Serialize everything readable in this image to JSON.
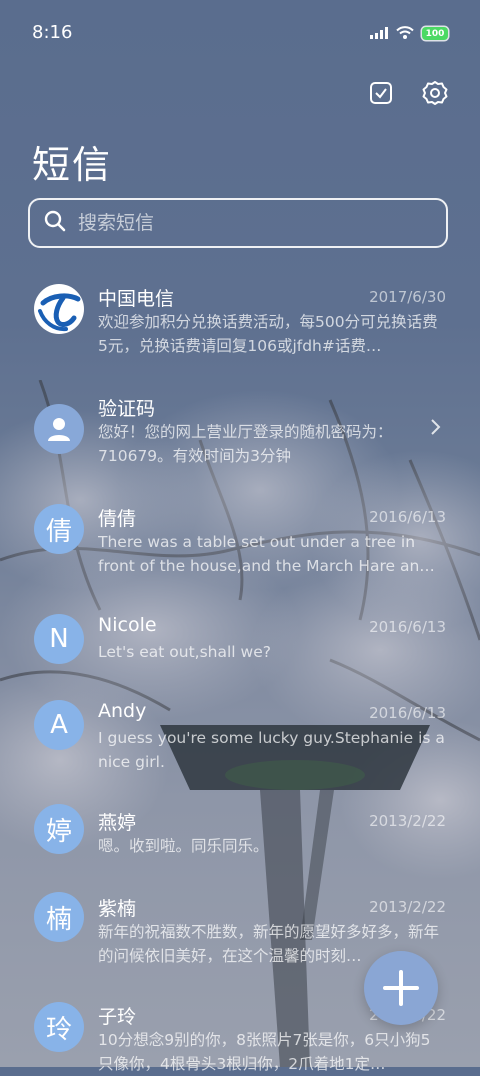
{
  "status": {
    "time": "8:16",
    "battery": "100"
  },
  "header": {
    "title": "短信"
  },
  "search": {
    "placeholder": "搜索短信"
  },
  "messages": [
    {
      "name": "中国电信",
      "date": "2017/6/30",
      "preview": "欢迎参加积分兑换话费活动，每500分可兑换话费5元，兑换话费请回复106或jfdh#话费…"
    },
    {
      "name": "验证码",
      "date": "",
      "preview": "您好！您的网上营业厅登录的随机密码为：710679。有效时间为3分钟"
    },
    {
      "name": "倩倩",
      "avatar": "倩",
      "date": "2016/6/13",
      "preview": "There was a table set out under a tree in front of the house,and the March Hare an…"
    },
    {
      "name": "Nicole",
      "avatar": "N",
      "date": "2016/6/13",
      "preview": "Let's eat out,shall we?"
    },
    {
      "name": "Andy",
      "avatar": "A",
      "date": "2016/6/13",
      "preview": "I guess you're some lucky guy.Stephanie is a nice girl."
    },
    {
      "name": "燕婷",
      "avatar": "婷",
      "date": "2013/2/22",
      "preview": "嗯。收到啦。同乐同乐。"
    },
    {
      "name": "紫楠",
      "avatar": "楠",
      "date": "2013/2/22",
      "preview": "新年的祝福数不胜数，新年的愿望好多好多，新年的问候依旧美好，在这个温馨的时刻…"
    },
    {
      "name": "子玲",
      "avatar": "玲",
      "date": "2013/2/22",
      "preview": "10分想念9别的你，8张照片7张是你，6只小狗5只像你，4根骨头3根归你，2爪着地1定…"
    }
  ],
  "icons": [
    "signal-icon",
    "wifi-icon",
    "select-icon",
    "gear-icon",
    "search-icon",
    "person-icon",
    "chevron-right-icon",
    "plus-icon"
  ]
}
